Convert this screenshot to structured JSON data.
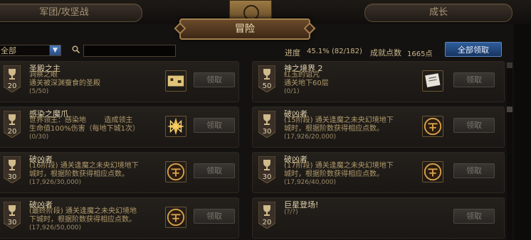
{
  "tabs": {
    "left": "军团/攻坚战",
    "right": "成长",
    "active": "冒险"
  },
  "filter": {
    "selected": "全部",
    "search_placeholder": ""
  },
  "stats": {
    "progress_label": "进度",
    "progress_value": "45.1% (82/182)",
    "points_label": "成就点数",
    "points_value": "1665点"
  },
  "claim_all_label": "全部领取",
  "claim_label": "领取",
  "achievements": [
    {
      "points": "20",
      "title": "圣殿之主",
      "desc": "洞察之眼\n通关被深渊蚕食的圣殿",
      "progress": "(5/50)",
      "icon": "map-icon",
      "col": 0
    },
    {
      "points": "50",
      "title": "神之境界 2",
      "desc": "红玉的诅咒\n通关地下60层",
      "progress": "(0/1)",
      "icon": "scroll-icon",
      "col": 1
    },
    {
      "points": "20",
      "title": "感染之魔爪",
      "desc": "世界领主：感染地        造成领主\n生命值100%伤害（每地下城1次）",
      "progress": "(0/30)",
      "icon": "burst-icon",
      "col": 0
    },
    {
      "points": "30",
      "title": "破凶者",
      "desc": "(15阶段) 通关逢魔之未央幻境地下\n城时，根据阶数获得相应点数。",
      "progress": "(17,926/20,000)",
      "icon": "rune-icon",
      "col": 1
    },
    {
      "points": "30",
      "title": "破凶者",
      "desc": "(16阶段) 通关逢魔之未央幻境地下\n城时，根据阶数获得相应点数。",
      "progress": "(17,926/30,000)",
      "icon": "rune-icon",
      "col": 0
    },
    {
      "points": "30",
      "title": "破凶者",
      "desc": "(17阶段) 通关逢魔之未央幻境地下\n城时，根据阶数获得相应点数。",
      "progress": "(17,926/40,000)",
      "icon": "rune-icon",
      "col": 1
    },
    {
      "points": "30",
      "title": "破凶者",
      "desc": "(最终阶段) 通关逢魔之未央幻境地\n下城时，根据阶数获得相应点数。",
      "progress": "(17,926/50,000)",
      "icon": "rune-icon",
      "col": 0
    },
    {
      "points": "20",
      "title": "巨星登场!",
      "desc": "",
      "progress": "(?/?)",
      "icon": "none",
      "col": 1
    }
  ]
}
